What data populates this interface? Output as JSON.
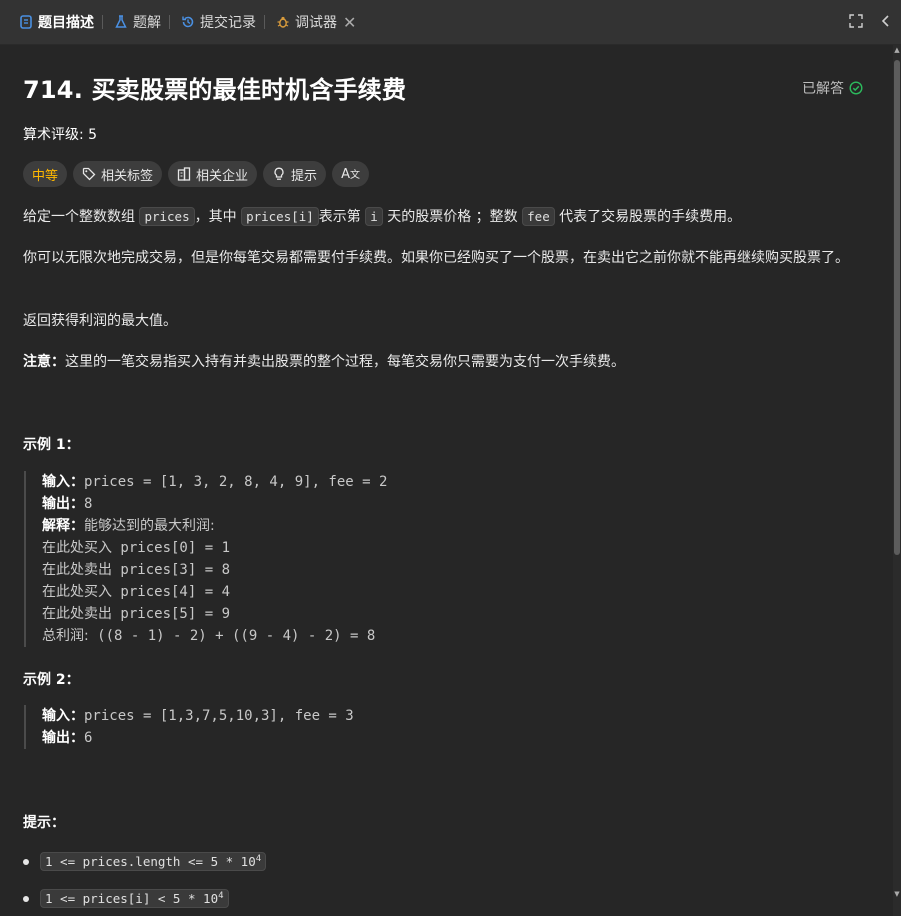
{
  "tabs": [
    {
      "label": "题目描述",
      "icon": "description-icon",
      "active": true
    },
    {
      "label": "题解",
      "icon": "flask-icon"
    },
    {
      "label": "提交记录",
      "icon": "history-icon"
    },
    {
      "label": "调试器",
      "icon": "bug-icon",
      "closable": true
    }
  ],
  "problem": {
    "title": "714. 买卖股票的最佳时机含手续费",
    "status": "已解答",
    "rating_label": "算术评级: 5",
    "chips": [
      "中等",
      "相关标签",
      "相关企业",
      "提示",
      "A文"
    ],
    "desc1": {
      "a": "给定一个整数数组 ",
      "c1": "prices",
      "b": "，其中 ",
      "c2": "prices[i]",
      "c": "表示第 ",
      "c3": "i",
      "d": " 天的股票价格 ；整数 ",
      "c4": "fee",
      "e": " 代表了交易股票的手续费用。"
    },
    "desc2": "你可以无限次地完成交易，但是你每笔交易都需要付手续费。如果你已经购买了一个股票，在卖出它之前你就不能再继续购买股票了。",
    "desc3": "返回获得利润的最大值。",
    "note_label": "注意：",
    "note": "这里的一笔交易指买入持有并卖出股票的整个过程，每笔交易你只需要为支付一次手续费。"
  },
  "example1": {
    "title": "示例 1：",
    "input_label": "输入：",
    "input": "prices = [1, 3, 2, 8, 4, 9], fee = 2",
    "output_label": "输出：",
    "output": "8",
    "explain_label": "解释：",
    "explain": "能够达到的最大利润:",
    "steps": [
      {
        "cn": "在此处买入",
        "code": " prices[0] = 1"
      },
      {
        "cn": "在此处卖出",
        "code": " prices[3] = 8"
      },
      {
        "cn": "在此处买入",
        "code": " prices[4] = 4"
      },
      {
        "cn": "在此处卖出",
        "code": " prices[5] = 9"
      }
    ],
    "total_cn": "总利润:",
    "total_code": " ((8 - 1) - 2) + ((9 - 4) - 2) = 8"
  },
  "example2": {
    "title": "示例 2：",
    "input_label": "输入：",
    "input": "prices = [1,3,7,5,10,3], fee = 3",
    "output_label": "输出：",
    "output": "6"
  },
  "hints": {
    "title": "提示：",
    "items": [
      {
        "text": "1 <= prices.length <= 5 * 10",
        "sup": "4"
      },
      {
        "text": "1 <= prices[i] < 5 * 10",
        "sup": "4"
      }
    ]
  },
  "colors": {
    "difficulty": "#ffb800",
    "solved_check": "#2cbb5d",
    "tab_active_icon": "#4a90e2"
  }
}
